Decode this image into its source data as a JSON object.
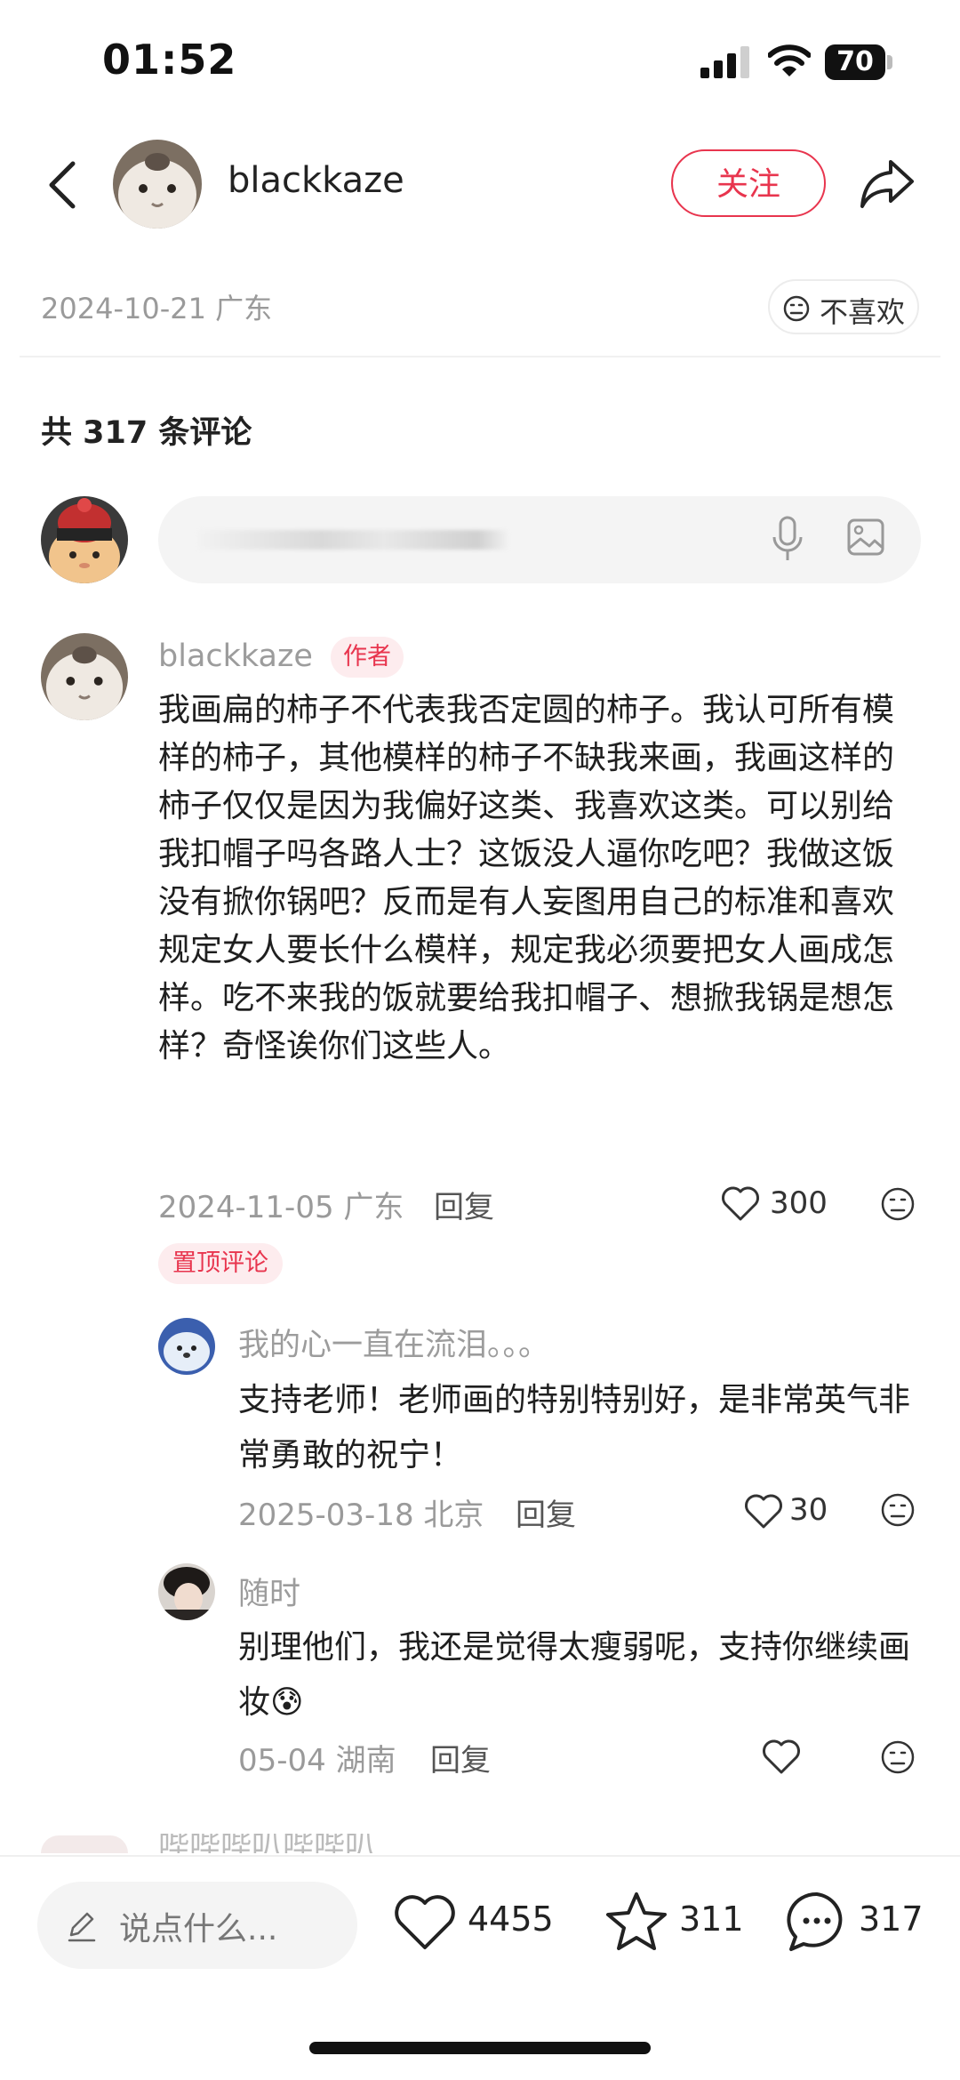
{
  "status_bar": {
    "time": "01:52",
    "battery": "70"
  },
  "header": {
    "author_name": "blackkaze",
    "follow_label": "关注"
  },
  "post_meta": {
    "date_location": "2024-10-21 广东",
    "dislike_label": "不喜欢"
  },
  "comments_section": {
    "count_text": "共 317 条评论"
  },
  "main_comment": {
    "user": "blackkaze",
    "badge": "作者",
    "text": "我画扁的柿子不代表我否定圆的柿子。我认可所有模样的柿子，其他模样的柿子不缺我来画，我画这样的柿子仅仅是因为我偏好这类、我喜欢这类。可以别给我扣帽子吗各路人士？这饭没人逼你吃吧？我做这饭没有掀你锅吧？反而是有人妄图用自己的标准和喜欢规定女人要长什么模样，规定我必须要把女人画成怎样。吃不来我的饭就要给我扣帽子、想掀我锅是想怎样？奇怪诶你们这些人。",
    "date_location": "2024-11-05 广东",
    "reply_label": "回复",
    "likes": "300",
    "pinned_label": "置顶评论"
  },
  "replies": [
    {
      "user": "我的心一直在流泪。。。",
      "text": "支持老师！老师画的特别特别好，是非常英气非常勇敢的祝宁！",
      "date_location": "2025-03-18 北京",
      "reply_label": "回复",
      "likes": "30"
    },
    {
      "user": "随时",
      "text": "别理他们，我还是觉得太瘦弱呢，支持你继续画妆😰",
      "date_location": "05-04 湖南",
      "reply_label": "回复"
    }
  ],
  "partial_next_user": "哔哔哔叭哔哔叭",
  "bottom_bar": {
    "input_placeholder": "说点什么...",
    "likes": "4455",
    "favorites": "311",
    "comments": "317"
  },
  "colors": {
    "accent": "#e8354e",
    "secondary_text": "#9a9a9a",
    "input_bg": "#f4f4f4"
  },
  "icons": [
    "back-icon",
    "share-icon",
    "signal-icon",
    "wifi-icon",
    "battery-icon",
    "mic-icon",
    "image-icon",
    "heart-icon",
    "dislike-face-icon",
    "pencil-icon",
    "star-icon",
    "comment-bubble-icon"
  ]
}
